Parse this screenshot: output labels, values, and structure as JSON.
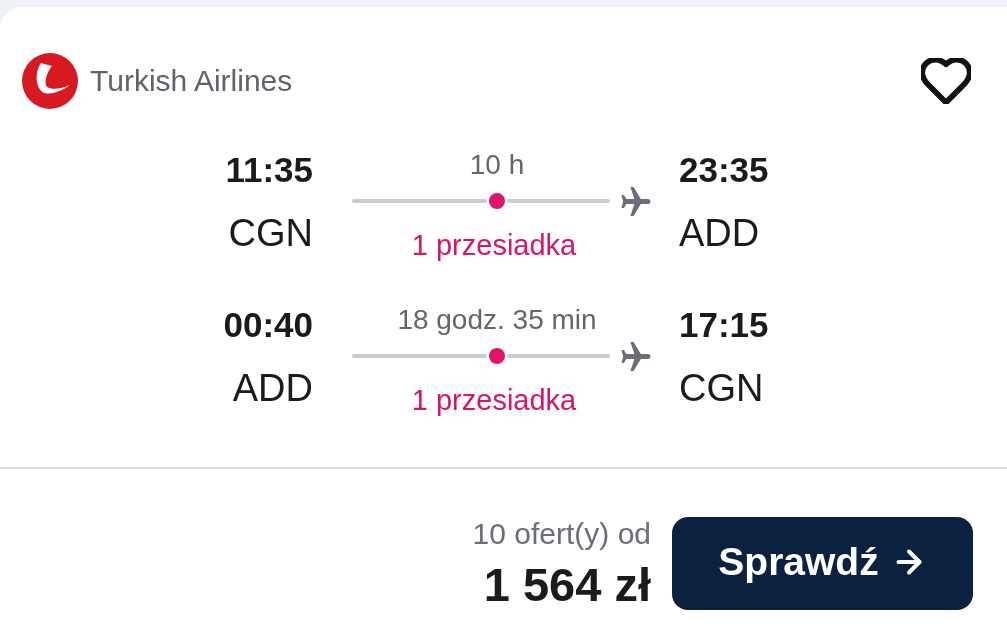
{
  "airline": {
    "name": "Turkish Airlines"
  },
  "favorite": {
    "selected": false
  },
  "legs": [
    {
      "departure": {
        "time": "11:35",
        "airport": "CGN"
      },
      "duration": "10 h",
      "stops": "1 przesiadka",
      "arrival": {
        "time": "23:35",
        "airport": "ADD"
      }
    },
    {
      "departure": {
        "time": "00:40",
        "airport": "ADD"
      },
      "duration": "18 godz. 35 min",
      "stops": "1 przesiadka",
      "arrival": {
        "time": "17:15",
        "airport": "CGN"
      }
    }
  ],
  "offer": {
    "count": "10 ofert(y) od",
    "price": "1 564 zł",
    "button": "Sprawdź"
  }
}
